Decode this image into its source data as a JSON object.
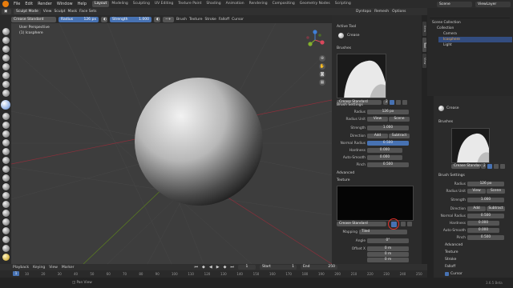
{
  "menubar": {
    "items": [
      "File",
      "Edit",
      "Render",
      "Window",
      "Help"
    ],
    "workspaces": [
      "Layout",
      "Modeling",
      "Sculpting",
      "UV Editing",
      "Texture Paint",
      "Shading",
      "Animation",
      "Rendering",
      "Compositing",
      "Geometry Nodes",
      "Scripting"
    ],
    "active_workspace": "Layout",
    "scene": "Scene",
    "view_layer": "ViewLayer"
  },
  "viewport_header": {
    "mode": "Sculpt Mode",
    "menus": [
      "View",
      "Sculpt",
      "Mask",
      "Face Sets"
    ],
    "right_menus": [
      "Dyntopo",
      "Remesh",
      "Options"
    ]
  },
  "tool_header": {
    "brush_name": "Crease Standard",
    "radius_label": "Radius",
    "radius_value": "126 px",
    "strength_label": "Strength",
    "strength_value": "1.000",
    "dropdowns": [
      "Brush",
      "Texture",
      "Stroke",
      "Falloff",
      "Cursor"
    ]
  },
  "viewport": {
    "perspective": "User Perspective",
    "object": "(1) Icosphere",
    "axes": {
      "x": "X",
      "y": "Y",
      "z": "Z"
    }
  },
  "properties": {
    "active_tool": "Active Tool",
    "tool_name": "Crease",
    "brushes": "Brushes",
    "brush_name": "Crease Standard",
    "brush_users": "2",
    "brush_settings": "Brush Settings",
    "rows": [
      {
        "label": "Radius",
        "value": "126 px"
      },
      {
        "label": "Radius Unit",
        "value": "View",
        "alt": "Scene"
      },
      {
        "label": "Strength",
        "value": "1.000"
      },
      {
        "label": "Direction",
        "value": "Add",
        "alt": "Subtract"
      },
      {
        "label": "Normal Radius",
        "value": "0.500"
      },
      {
        "label": "Hardness",
        "value": "0.000"
      },
      {
        "label": "Auto-Smooth",
        "value": "0.000"
      },
      {
        "label": "Pinch",
        "value": "0.500"
      }
    ],
    "advanced": "Advanced",
    "texture": "Texture",
    "texture_brush_name": "Crease Standard",
    "mapping_label": "Mapping",
    "mapping_value": "Tiled",
    "angle_label": "Angle",
    "angle_value": "0°",
    "offset_label": "Offset X",
    "offset_values": [
      "0 m",
      "0 m",
      "0 m"
    ]
  },
  "outliner": {
    "title": "Scene Collection",
    "items": [
      "Collection",
      "Camera",
      "Icosphere",
      "Light"
    ]
  },
  "right_properties": {
    "tool_name": "Crease",
    "brushes": "Brushes",
    "brush_name": "Crease Standard",
    "brush_users": "2",
    "brush_settings": "Brush Settings",
    "rows": [
      {
        "label": "Radius",
        "value": "126 px"
      },
      {
        "label": "Radius Unit",
        "value": "View",
        "alt": "Scene"
      },
      {
        "label": "Strength",
        "value": "1.000"
      },
      {
        "label": "Direction",
        "value": "Add",
        "alt": "Subtract"
      },
      {
        "label": "Normal Radius",
        "value": "0.500"
      },
      {
        "label": "Hardness",
        "value": "0.000"
      },
      {
        "label": "Auto-Smooth",
        "value": "0.000"
      },
      {
        "label": "Pinch",
        "value": "0.500"
      }
    ],
    "subpanels": [
      "Advanced",
      "Texture",
      "Stroke",
      "Falloff",
      "Cursor"
    ]
  },
  "timeline": {
    "menus": [
      "Playback",
      "Keying",
      "View",
      "Marker"
    ],
    "current_frame": "1",
    "start_label": "Start",
    "start": "1",
    "end_label": "End",
    "end": "250",
    "ticks": [
      "10",
      "20",
      "30",
      "40",
      "50",
      "60",
      "70",
      "80",
      "90",
      "100",
      "110",
      "120",
      "130",
      "140",
      "150",
      "160",
      "170",
      "180",
      "190",
      "200",
      "210",
      "220",
      "230",
      "240",
      "250"
    ]
  },
  "status": {
    "hint": "Pan View",
    "version": "3.6.5 Beta"
  },
  "colors": {
    "accent": "#4772b3",
    "highlight_circle": "#e0312b"
  }
}
